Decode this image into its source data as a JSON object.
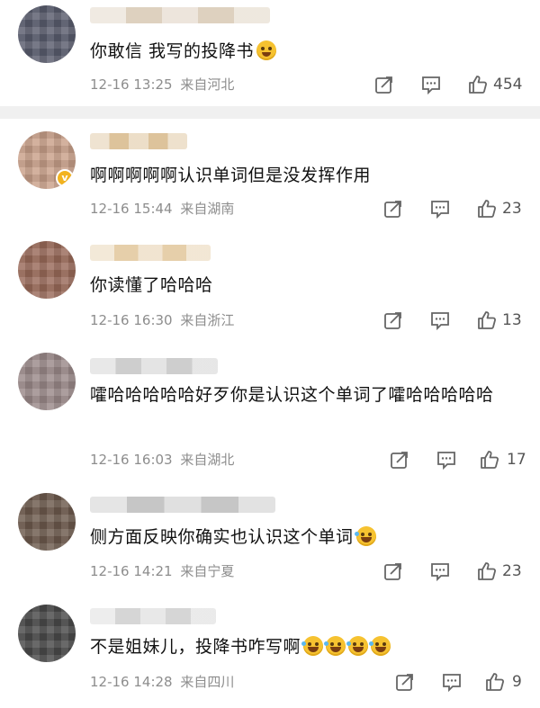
{
  "comments": [
    {
      "text": "你敢信 我写的投降书",
      "emojis": [
        "cry"
      ],
      "time": "12-16 13:25",
      "location": "来自河北",
      "likes": "454",
      "avatar_color": "#5a5e6e",
      "username_color": "#d9c9b4",
      "verified": false
    },
    {
      "text": "啊啊啊啊啊认识单词但是没发挥作用",
      "emojis": [],
      "time": "12-16 15:44",
      "location": "来自湖南",
      "likes": "23",
      "avatar_color": "#c9a08a",
      "username_color": "#d8b98a",
      "verified": true
    },
    {
      "text": "你读懂了哈哈哈",
      "emojis": [],
      "time": "12-16 16:30",
      "location": "来自浙江",
      "likes": "13",
      "avatar_color": "#9a6b5a",
      "username_color": "#e2c79c",
      "verified": false
    },
    {
      "text": "嚯哈哈哈哈哈好歹你是认识这个单词了嚯哈哈哈哈哈",
      "emojis": [],
      "time": "12-16 16:03",
      "location": "来自湖北",
      "likes": "17",
      "avatar_color": "#9b8a8a",
      "username_color": "#c6c6c6",
      "verified": false
    },
    {
      "text": "侧方面反映你确实也认识这个单词",
      "emojis": [
        "laugh"
      ],
      "time": "12-16 14:21",
      "location": "来自宁夏",
      "likes": "23",
      "avatar_color": "#6d5a4e",
      "username_color": "#bdbdbd",
      "verified": false
    },
    {
      "text": "不是姐妹儿，投降书咋写啊",
      "emojis": [
        "laugh",
        "laugh",
        "laugh",
        "laugh"
      ],
      "time": "12-16 14:28",
      "location": "来自四川",
      "likes": "9",
      "avatar_color": "#4a4a4a",
      "username_color": "#d0d0d0",
      "verified": false
    }
  ],
  "icons": {
    "repost": "repost-icon",
    "comment": "comment-icon",
    "like": "thumbs-up-icon"
  }
}
